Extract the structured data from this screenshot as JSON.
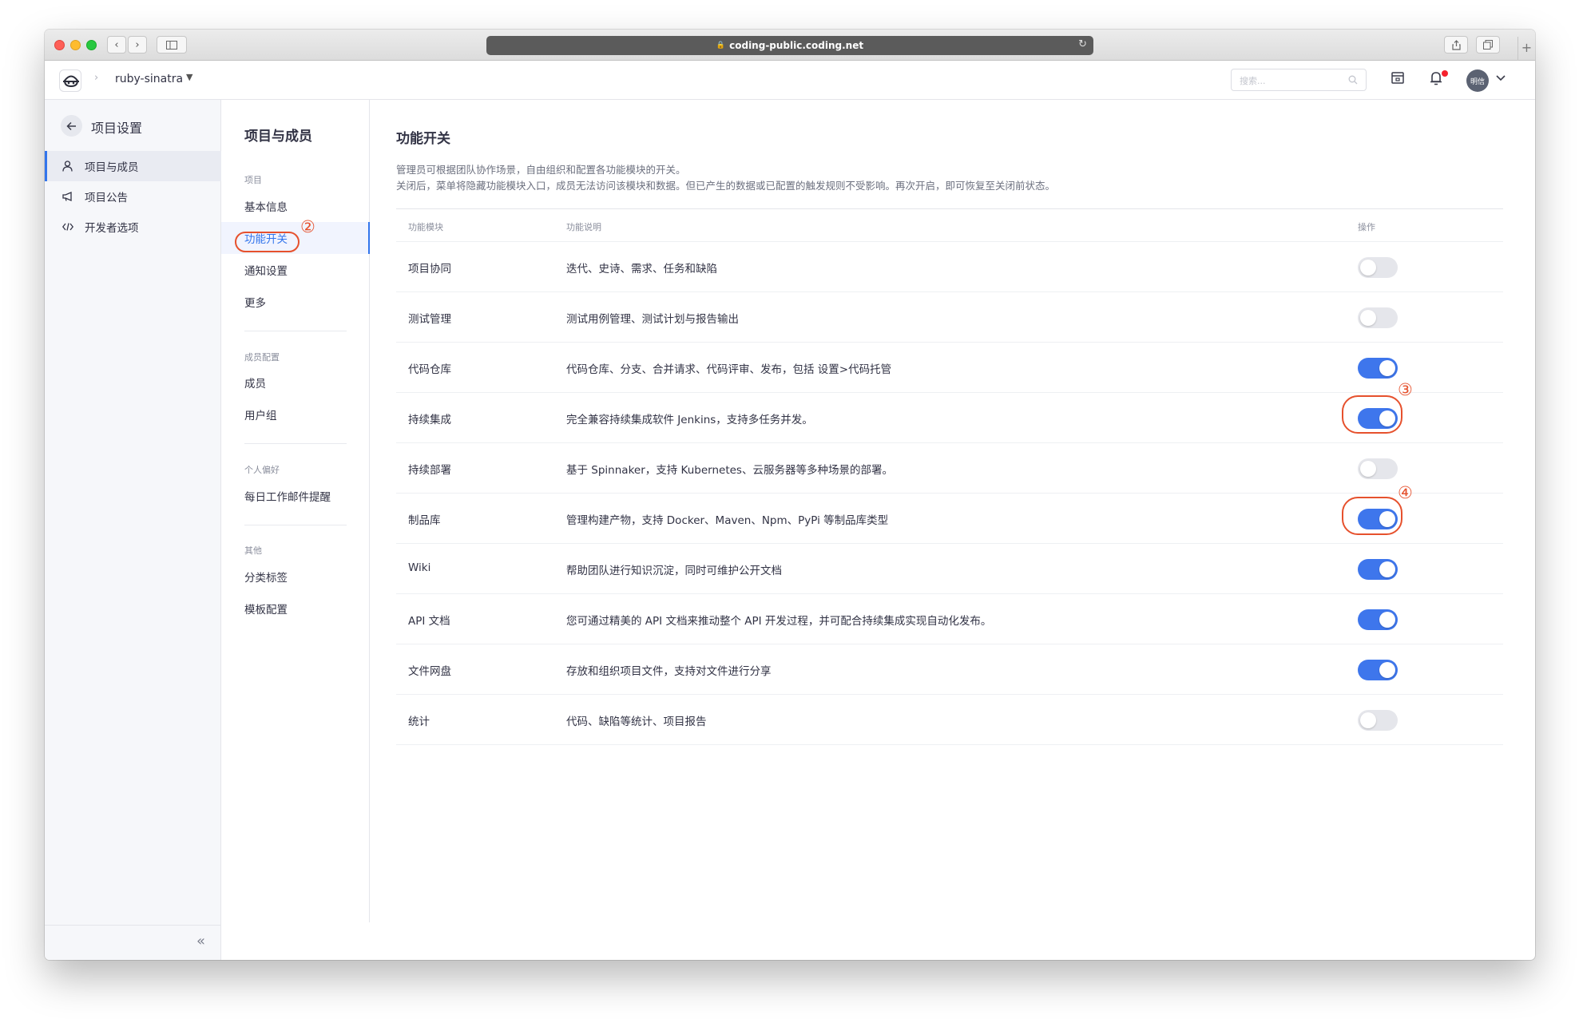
{
  "browser": {
    "url": "coding-public.coding.net"
  },
  "header": {
    "project_name": "ruby-sinatra",
    "search_placeholder": "搜索...",
    "avatar_text": "明信"
  },
  "sidebar": {
    "title": "项目设置",
    "items": [
      {
        "label": "项目与成员",
        "icon": "user-icon",
        "active": true
      },
      {
        "label": "项目公告",
        "icon": "megaphone-icon",
        "active": false
      },
      {
        "label": "开发者选项",
        "icon": "code-icon",
        "active": false
      }
    ]
  },
  "subnav": {
    "title": "项目与成员",
    "groups": [
      {
        "label": "项目",
        "items": [
          "基本信息",
          "功能开关",
          "通知设置",
          "更多"
        ]
      },
      {
        "label": "成员配置",
        "items": [
          "成员",
          "用户组"
        ]
      },
      {
        "label": "个人偏好",
        "items": [
          "每日工作邮件提醒"
        ]
      },
      {
        "label": "其他",
        "items": [
          "分类标签",
          "模板配置"
        ]
      }
    ],
    "active_item": "功能开关"
  },
  "main": {
    "title": "功能开关",
    "desc_line1": "管理员可根据团队协作场景，自由组织和配置各功能模块的开关。",
    "desc_line2": "关闭后，菜单将隐藏功能模块入口，成员无法访问该模块和数据。但已产生的数据或已配置的触发规则不受影响。再次开启，即可恢复至关闭前状态。",
    "columns": [
      "功能模块",
      "功能说明",
      "操作"
    ],
    "rows": [
      {
        "module": "项目协同",
        "desc": "迭代、史诗、需求、任务和缺陷",
        "enabled": false
      },
      {
        "module": "测试管理",
        "desc": "测试用例管理、测试计划与报告输出",
        "enabled": false
      },
      {
        "module": "代码仓库",
        "desc": "代码仓库、分支、合并请求、代码评审、发布，包括 设置>代码托管",
        "enabled": true
      },
      {
        "module": "持续集成",
        "desc": "完全兼容持续集成软件 Jenkins，支持多任务并发。",
        "enabled": true
      },
      {
        "module": "持续部署",
        "desc": "基于 Spinnaker，支持 Kubernetes、云服务器等多种场景的部署。",
        "enabled": false
      },
      {
        "module": "制品库",
        "desc": "管理构建产物，支持 Docker、Maven、Npm、PyPi 等制品库类型",
        "enabled": true
      },
      {
        "module": "Wiki",
        "desc": "帮助团队进行知识沉淀，同时可维护公开文档",
        "enabled": true
      },
      {
        "module": "API 文档",
        "desc": "您可通过精美的 API 文档来推动整个 API 开发过程，并可配合持续集成实现自动化发布。",
        "enabled": true
      },
      {
        "module": "文件网盘",
        "desc": "存放和组织项目文件，支持对文件进行分享",
        "enabled": true
      },
      {
        "module": "统计",
        "desc": "代码、缺陷等统计、项目报告",
        "enabled": false
      }
    ]
  },
  "annotations": {
    "a2": "②",
    "a3": "③",
    "a4": "④"
  },
  "colors": {
    "accent": "#3e76ec",
    "annotation": "#e6512d",
    "toggle_off": "#e5e6eb"
  }
}
